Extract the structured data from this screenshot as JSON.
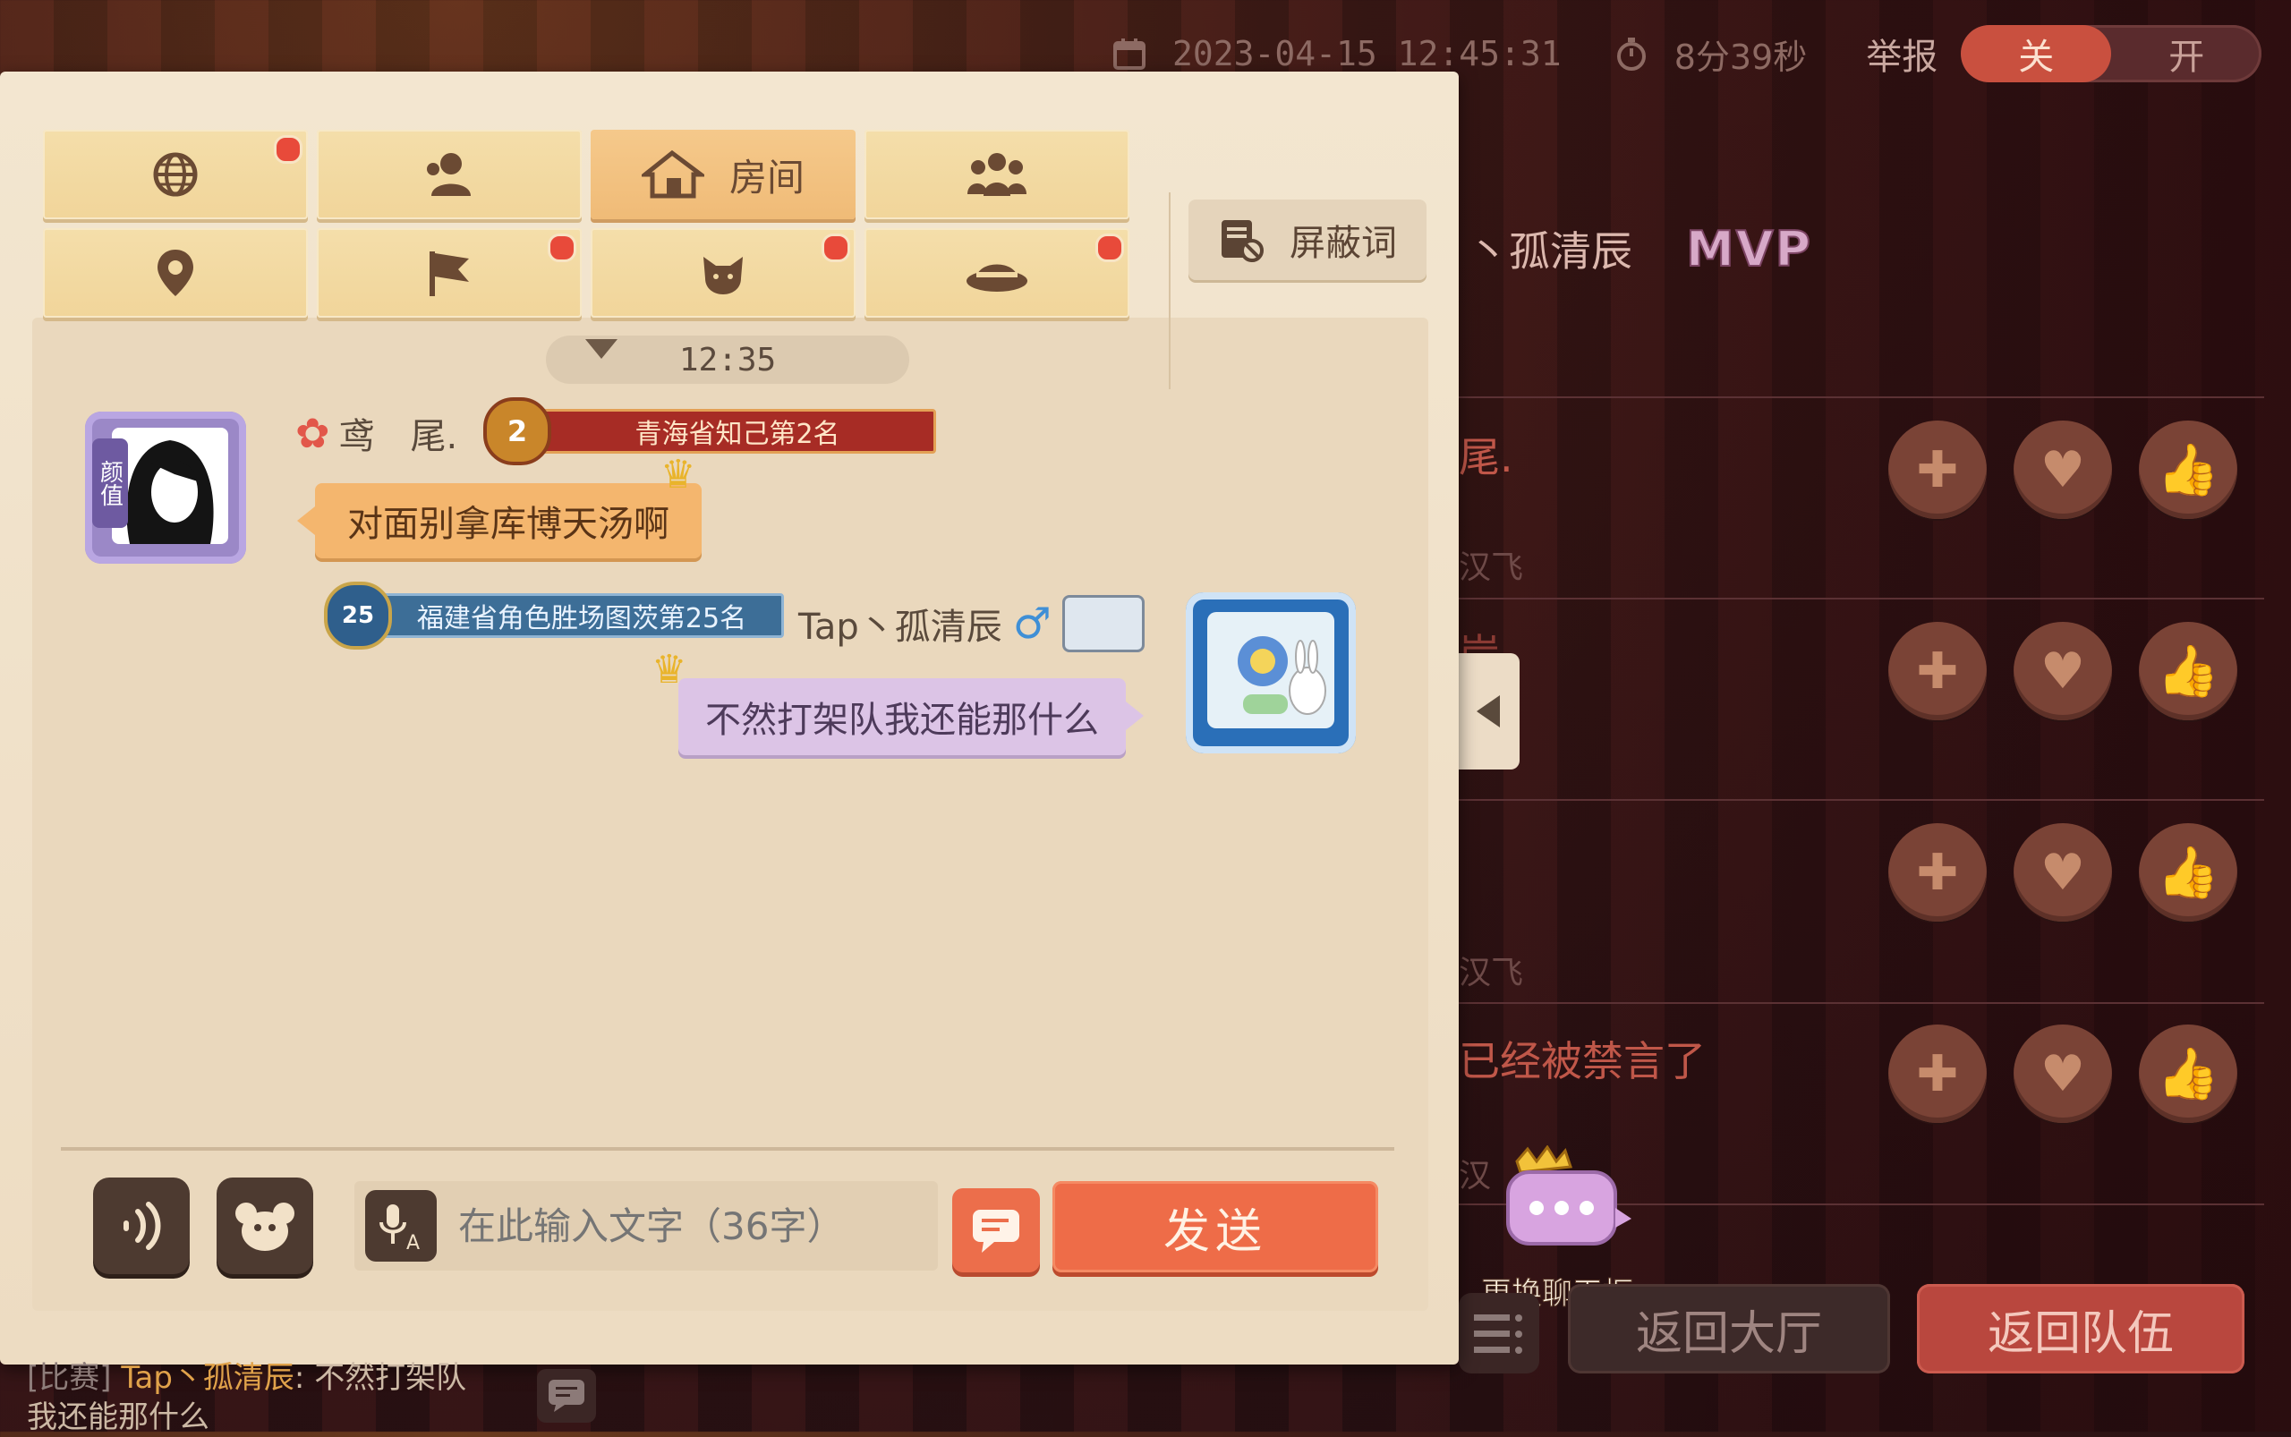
{
  "topbar": {
    "datetime": "2023-04-15 12:45:31",
    "duration": "8分39秒",
    "report_label": "举报",
    "toggle_off": "关",
    "toggle_on": "开"
  },
  "tabs": [
    {
      "icon": "globe-icon",
      "label": "",
      "badge": true,
      "active": false
    },
    {
      "icon": "person-icon",
      "label": "",
      "badge": false,
      "active": false
    },
    {
      "icon": "house-icon",
      "label": "房间",
      "badge": false,
      "active": true
    },
    {
      "icon": "group-icon",
      "label": "",
      "badge": false,
      "active": false
    },
    {
      "icon": "location-pin-icon",
      "label": "",
      "badge": false,
      "active": false
    },
    {
      "icon": "flag-icon",
      "label": "",
      "badge": true,
      "active": false
    },
    {
      "icon": "cat-icon",
      "label": "",
      "badge": true,
      "active": false
    },
    {
      "icon": "hat-icon",
      "label": "",
      "badge": true,
      "active": false
    }
  ],
  "block_words_label": "屏蔽词",
  "chat": {
    "time": "12:35",
    "msg1": {
      "avatar_tag": "颜值",
      "name": "鸢　尾.",
      "rank_number": "2",
      "rank_title": "青海省知己第2名",
      "text": "对面别拿库博天汤啊"
    },
    "msg2": {
      "rank_number": "25",
      "rank_title": "福建省角色胜场图茨第25名",
      "name": "Tap丶孤清辰",
      "text": "不然打架队我还能那什么"
    }
  },
  "input": {
    "placeholder": "在此输入文字（36字）",
    "send_label": "发送"
  },
  "ticker": {
    "tag": "[比赛]",
    "name": "Tap丶孤清辰",
    "sep": ":",
    "text1": "不然打架队",
    "text2": "我还能那什么"
  },
  "right": {
    "mvp_name": "丶孤清辰",
    "mvp_badge": "MVP",
    "row1_name": "尾.",
    "row1_sub": "汉飞",
    "row2_name": "岸",
    "row3_sub": "汉飞",
    "row4_text": "已经被禁言了",
    "row4_sub": "汉",
    "bubble_change": "更换聊天框",
    "btn_lobby": "返回大厅",
    "btn_team": "返回队伍"
  }
}
